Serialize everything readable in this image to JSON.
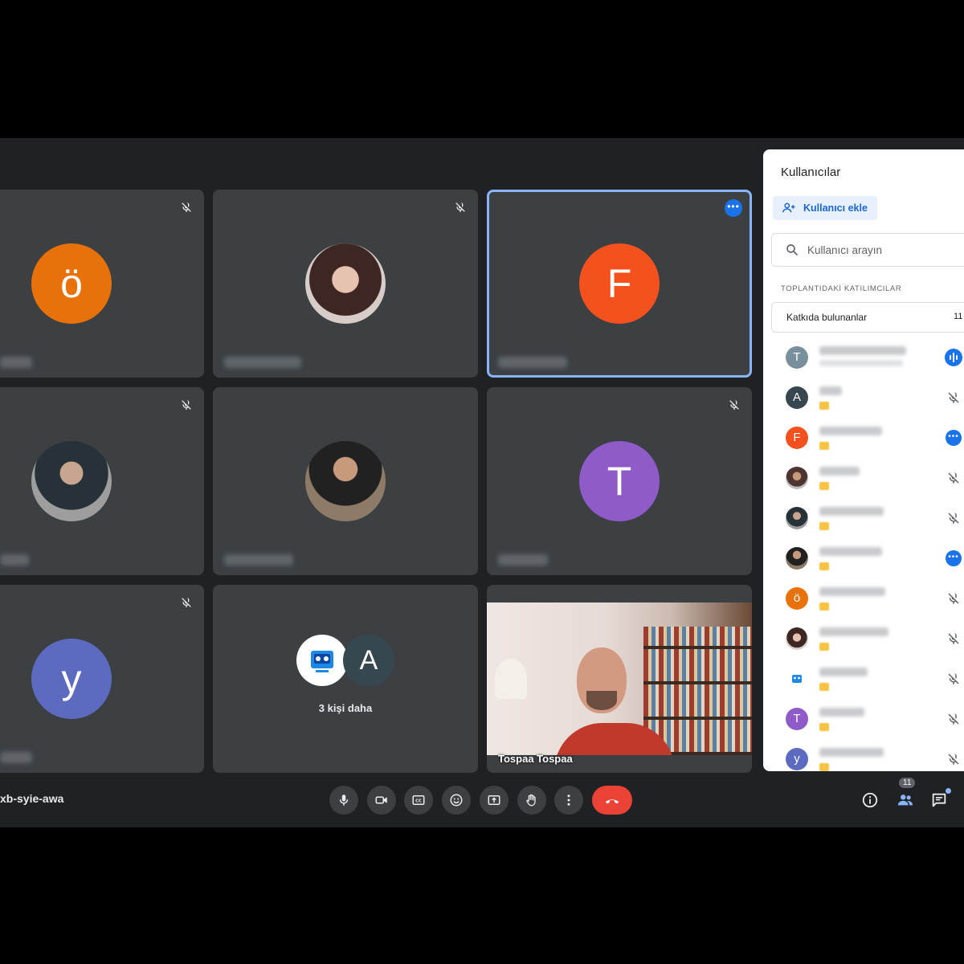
{
  "meeting": {
    "code": "xb-syie-awa"
  },
  "colors": {
    "tile_bg": "#3c4043",
    "active_border": "#8ab4f8",
    "accent": "#1a73e8",
    "end_call": "#ea4335"
  },
  "tiles": [
    {
      "avatar_letter": "ö",
      "avatar_color": "#e8710a",
      "status": "mic-off"
    },
    {
      "avatar_letter": "",
      "avatar_color": "#8d6e63",
      "status": "mic-off"
    },
    {
      "avatar_letter": "F",
      "avatar_color": "#f4511e",
      "status": "more",
      "active": true
    },
    {
      "avatar_letter": "",
      "avatar_color": "#616161",
      "status": "mic-off"
    },
    {
      "avatar_letter": "",
      "avatar_color": "#795548",
      "status": "none"
    },
    {
      "avatar_letter": "T",
      "avatar_color": "#8e5bc9",
      "status": "mic-off"
    },
    {
      "avatar_letter": "y",
      "avatar_color": "#5c6bc0",
      "status": "mic-off"
    }
  ],
  "more_people": {
    "label": "3 kişi daha",
    "second_letter": "A",
    "second_color": "#37474f"
  },
  "video_tile": {
    "name": "Tospaa Tospaa"
  },
  "controls": {
    "mic": "mic-icon",
    "camera": "camera-icon",
    "captions": "captions-icon",
    "emoji": "emoji-icon",
    "present": "present-icon",
    "raise_hand": "hand-icon",
    "more": "more-vert-icon",
    "end": "end-call-icon"
  },
  "side_controls": {
    "participants_count": "11"
  },
  "panel": {
    "title": "Kullanıcılar",
    "add_button": "Kullanıcı ekle",
    "search_placeholder": "Kullanıcı arayın",
    "section_label": "TOPLANTIDAKİ KATILIMCILAR",
    "contributors_label": "Katkıda bulunanlar",
    "contributors_count": "11",
    "participants": [
      {
        "letter": "T",
        "color": "#78909c",
        "status": "speaking"
      },
      {
        "letter": "A",
        "color": "#37474f",
        "status": "mic-off"
      },
      {
        "letter": "F",
        "color": "#f4511e",
        "status": "more"
      },
      {
        "letter": "",
        "color": "#8d6e63",
        "status": "mic-off"
      },
      {
        "letter": "",
        "color": "#616161",
        "status": "mic-off"
      },
      {
        "letter": "",
        "color": "#795548",
        "status": "more"
      },
      {
        "letter": "ö",
        "color": "#e8710a",
        "status": "mic-off"
      },
      {
        "letter": "",
        "color": "#a1887f",
        "status": "mic-off"
      },
      {
        "letter": "",
        "color": "#29b6f6",
        "status": "mic-off"
      },
      {
        "letter": "T",
        "color": "#8e5bc9",
        "status": "mic-off"
      },
      {
        "letter": "y",
        "color": "#5c6bc0",
        "status": "mic-off"
      }
    ]
  }
}
